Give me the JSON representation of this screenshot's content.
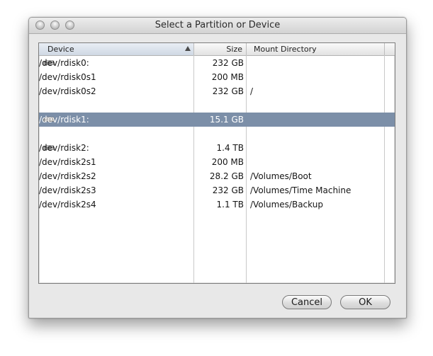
{
  "window": {
    "title": "Select a Partition or Device"
  },
  "table": {
    "columns": {
      "device": "Device",
      "size": "Size",
      "mount": "Mount Directory"
    },
    "rows": [
      {
        "device": "/dev/rdisk0:",
        "size": "232 GB",
        "mount": "",
        "is_disk": true,
        "selected": false
      },
      {
        "device": "/dev/rdisk0s1",
        "size": "200 MB",
        "mount": "",
        "is_disk": false,
        "selected": false
      },
      {
        "device": "/dev/rdisk0s2",
        "size": "232 GB",
        "mount": "/",
        "is_disk": false,
        "selected": false
      },
      {
        "device": "",
        "size": "",
        "mount": "",
        "is_disk": false,
        "selected": false,
        "spacer": true
      },
      {
        "device": "/dev/rdisk1:",
        "size": "15.1 GB",
        "mount": "",
        "is_disk": true,
        "selected": true
      },
      {
        "device": "",
        "size": "",
        "mount": "",
        "is_disk": false,
        "selected": false,
        "spacer": true
      },
      {
        "device": "/dev/rdisk2:",
        "size": "1.4 TB",
        "mount": "",
        "is_disk": true,
        "selected": false
      },
      {
        "device": "/dev/rdisk2s1",
        "size": "200 MB",
        "mount": "",
        "is_disk": false,
        "selected": false
      },
      {
        "device": "/dev/rdisk2s2",
        "size": "28.2 GB",
        "mount": "/Volumes/Boot",
        "is_disk": false,
        "selected": false
      },
      {
        "device": "/dev/rdisk2s3",
        "size": "232 GB",
        "mount": "/Volumes/Time Machine",
        "is_disk": false,
        "selected": false
      },
      {
        "device": "/dev/rdisk2s4",
        "size": "1.1 TB",
        "mount": "/Volumes/Backup",
        "is_disk": false,
        "selected": false
      }
    ]
  },
  "buttons": {
    "cancel": "Cancel",
    "ok": "OK"
  },
  "icons": {
    "disk": "hard-disk-icon",
    "sort": "sort-ascending-icon"
  },
  "colors": {
    "selection": "#7c8fa8"
  }
}
